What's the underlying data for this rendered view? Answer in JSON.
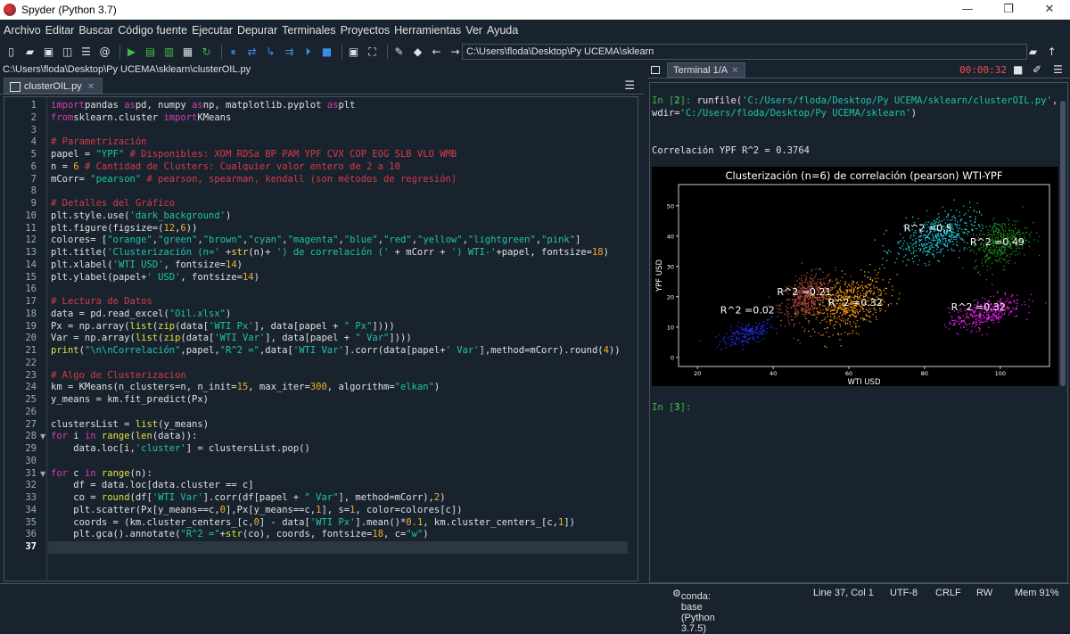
{
  "window": {
    "title": "Spyder (Python 3.7)"
  },
  "menu": [
    "Archivo",
    "Editar",
    "Buscar",
    "Código fuente",
    "Ejecutar",
    "Depurar",
    "Terminales",
    "Proyectos",
    "Herramientas",
    "Ver",
    "Ayuda"
  ],
  "toolbar": {
    "working_dir": "C:\\Users\\floda\\Desktop\\Py UCEMA\\sklearn"
  },
  "editor": {
    "file_path": "C:\\Users\\floda\\Desktop\\Py UCEMA\\sklearn\\clusterOIL.py",
    "tab_label": "clusterOIL.py",
    "current_line": 37,
    "fold_lines": [
      28,
      31
    ],
    "lines": [
      [
        [
          "kw",
          "import"
        ],
        [
          "",
          "pandas "
        ],
        [
          "kw",
          "as"
        ],
        [
          "",
          "pd, numpy "
        ],
        [
          "kw",
          "as"
        ],
        [
          "",
          "np, matplotlib.pyplot "
        ],
        [
          "kw",
          "as"
        ],
        [
          "",
          "plt"
        ]
      ],
      [
        [
          "kw",
          "from"
        ],
        [
          "",
          "sklearn.cluster "
        ],
        [
          "kw",
          "import"
        ],
        [
          "",
          "KMeans"
        ]
      ],
      [],
      [
        [
          "cm",
          "# Parametrización"
        ]
      ],
      [
        [
          "",
          "papel = "
        ],
        [
          "st",
          "\"YPF\""
        ],
        [
          "cm",
          " # Disponibles: XOM RDSa BP PAM YPF CVX COP EOG SLB VLO WMB"
        ]
      ],
      [
        [
          "",
          "n = "
        ],
        [
          "nm",
          "6"
        ],
        [
          "cm",
          " # Cantidad de Clusters: Cualquier valor entero de 2 a 10"
        ]
      ],
      [
        [
          "",
          "mCorr= "
        ],
        [
          "st",
          "\"pearson\""
        ],
        [
          "cm",
          " # pearson, spearman, kendall (son métodos de regresión)"
        ]
      ],
      [],
      [
        [
          "cm",
          "# Detalles del Gráfico"
        ]
      ],
      [
        [
          "",
          "plt.style.use("
        ],
        [
          "st",
          "'dark_background'"
        ],
        [
          "",
          ")"
        ]
      ],
      [
        [
          "",
          "plt.figure(figsize=("
        ],
        [
          "nm",
          "12"
        ],
        [
          "",
          ","
        ],
        [
          "nm",
          "6"
        ],
        [
          "",
          "))"
        ]
      ],
      [
        [
          "",
          "colores= ["
        ],
        [
          "st",
          "\"orange\""
        ],
        [
          "",
          ","
        ],
        [
          "st",
          "\"green\""
        ],
        [
          "",
          ","
        ],
        [
          "st",
          "\"brown\""
        ],
        [
          "",
          ","
        ],
        [
          "st",
          "\"cyan\""
        ],
        [
          "",
          ","
        ],
        [
          "st",
          "\"magenta\""
        ],
        [
          "",
          ","
        ],
        [
          "st",
          "\"blue\""
        ],
        [
          "",
          ","
        ],
        [
          "st",
          "\"red\""
        ],
        [
          "",
          ","
        ],
        [
          "st",
          "\"yellow\""
        ],
        [
          "",
          ","
        ],
        [
          "st",
          "\"lightgreen\""
        ],
        [
          "",
          ","
        ],
        [
          "st",
          "\"pink\""
        ],
        [
          "",
          "]"
        ]
      ],
      [
        [
          "",
          "plt.title("
        ],
        [
          "st",
          "'Clusterización (n='"
        ],
        [
          "",
          " +"
        ],
        [
          "bi",
          "str"
        ],
        [
          "",
          "(n)+ "
        ],
        [
          "st",
          "') de correlación ('"
        ],
        [
          "",
          " + mCorr + "
        ],
        [
          "st",
          "') WTI-'"
        ],
        [
          "",
          "+papel, fontsize="
        ],
        [
          "nm",
          "18"
        ],
        [
          "",
          ")"
        ]
      ],
      [
        [
          "",
          "plt.xlabel("
        ],
        [
          "st",
          "'WTI USD'"
        ],
        [
          "",
          ", fontsize="
        ],
        [
          "nm",
          "14"
        ],
        [
          "",
          ")"
        ]
      ],
      [
        [
          "",
          "plt.ylabel(papel+"
        ],
        [
          "st",
          "' USD'"
        ],
        [
          "",
          ", fontsize="
        ],
        [
          "nm",
          "14"
        ],
        [
          "",
          ")"
        ]
      ],
      [],
      [
        [
          "cm",
          "# Lectura de Datos"
        ]
      ],
      [
        [
          "",
          "data = pd.read_excel("
        ],
        [
          "st",
          "\"Oil.xlsx\""
        ],
        [
          "",
          ")"
        ]
      ],
      [
        [
          "",
          "Px = np.array("
        ],
        [
          "bi",
          "list"
        ],
        [
          "",
          "("
        ],
        [
          "bi",
          "zip"
        ],
        [
          "",
          "(data["
        ],
        [
          "st",
          "'WTI Px'"
        ],
        [
          "",
          "], data[papel + "
        ],
        [
          "st",
          "\" Px\""
        ],
        [
          "",
          "])))"
        ]
      ],
      [
        [
          "",
          "Var = np.array("
        ],
        [
          "bi",
          "list"
        ],
        [
          "",
          "("
        ],
        [
          "bi",
          "zip"
        ],
        [
          "",
          "(data["
        ],
        [
          "st",
          "'WTI Var'"
        ],
        [
          "",
          "], data[papel + "
        ],
        [
          "st",
          "\" Var\""
        ],
        [
          "",
          "])))"
        ]
      ],
      [
        [
          "bi",
          "print"
        ],
        [
          "",
          "("
        ],
        [
          "st",
          "\"\\n\\nCorrelación\""
        ],
        [
          "",
          ",papel,"
        ],
        [
          "st",
          "\"R^2 =\""
        ],
        [
          "",
          ",data["
        ],
        [
          "st",
          "'WTI Var'"
        ],
        [
          "",
          "].corr(data[papel+"
        ],
        [
          "st",
          "' Var'"
        ],
        [
          "",
          "],method=mCorr).round("
        ],
        [
          "nm",
          "4"
        ],
        [
          "",
          "))"
        ]
      ],
      [],
      [
        [
          "cm",
          "# Algo de Clusterizacion"
        ]
      ],
      [
        [
          "",
          "km = KMeans(n_clusters=n, n_init="
        ],
        [
          "nm",
          "15"
        ],
        [
          "",
          ", max_iter="
        ],
        [
          "nm",
          "300"
        ],
        [
          "",
          ", algorithm="
        ],
        [
          "st",
          "\"elkan\""
        ],
        [
          "",
          ")"
        ]
      ],
      [
        [
          "",
          "y_means = km.fit_predict(Px)"
        ]
      ],
      [],
      [
        [
          "",
          "clustersList = "
        ],
        [
          "bi",
          "list"
        ],
        [
          "",
          "(y_means)"
        ]
      ],
      [
        [
          "kw",
          "for"
        ],
        [
          "",
          " i "
        ],
        [
          "kw",
          "in"
        ],
        [
          "",
          " "
        ],
        [
          "bi",
          "range"
        ],
        [
          "",
          "("
        ],
        [
          "bi",
          "len"
        ],
        [
          "",
          "(data)):"
        ]
      ],
      [
        [
          "",
          "    data.loc[i,"
        ],
        [
          "st",
          "'cluster'"
        ],
        [
          "",
          "] = clustersList.pop()"
        ]
      ],
      [],
      [
        [
          "kw",
          "for"
        ],
        [
          "",
          " c "
        ],
        [
          "kw",
          "in"
        ],
        [
          "",
          " "
        ],
        [
          "bi",
          "range"
        ],
        [
          "",
          "(n):"
        ]
      ],
      [
        [
          "",
          "    df = data.loc[data.cluster == c]"
        ]
      ],
      [
        [
          "",
          "    co = "
        ],
        [
          "bi",
          "round"
        ],
        [
          "",
          "(df["
        ],
        [
          "st",
          "'WTI Var'"
        ],
        [
          "",
          "].corr(df[papel + "
        ],
        [
          "st",
          "\" Var\""
        ],
        [
          "",
          "], method=mCorr),"
        ],
        [
          "nm",
          "2"
        ],
        [
          "",
          ")"
        ]
      ],
      [
        [
          "",
          "    plt.scatter(Px[y_means==c,"
        ],
        [
          "nm",
          "0"
        ],
        [
          "",
          "],Px[y_means==c,"
        ],
        [
          "nm",
          "1"
        ],
        [
          "",
          "], s="
        ],
        [
          "nm",
          "1"
        ],
        [
          "",
          ", color=colores[c])"
        ]
      ],
      [
        [
          "",
          "    coords = (km.cluster_centers_[c,"
        ],
        [
          "nm",
          "0"
        ],
        [
          "",
          "] - data["
        ],
        [
          "st",
          "'WTI Px'"
        ],
        [
          "",
          "].mean()*"
        ],
        [
          "nm",
          "0.1"
        ],
        [
          "",
          ", km.cluster_centers_[c,"
        ],
        [
          "nm",
          "1"
        ],
        [
          "",
          "])"
        ]
      ],
      [
        [
          "",
          "    plt.gca().annotate("
        ],
        [
          "st",
          "\"R^2 =\""
        ],
        [
          "",
          "+"
        ],
        [
          "bi",
          "str"
        ],
        [
          "",
          "(co), coords, fontsize="
        ],
        [
          "nm",
          "18"
        ],
        [
          "",
          ", c="
        ],
        [
          "st",
          "\"w\""
        ],
        [
          "",
          ")"
        ]
      ],
      []
    ]
  },
  "console": {
    "tab_label": "Terminal 1/A",
    "timer": "00:00:32",
    "in_label": "In [",
    "in2_num": "2",
    "in2_end": "]: ",
    "in2_cmd_a": "runfile(",
    "in2_str1": "'C:/Users/floda/Desktop/Py UCEMA/sklearn/clusterOIL.py'",
    "in2_cmd_b": ",",
    "in2_cmd_c": "wdir=",
    "in2_str2": "'C:/Users/floda/Desktop/Py UCEMA/sklearn'",
    "in2_cmd_d": ")",
    "output": "Correlación YPF R^2 = 0.3764",
    "in3_num": "3",
    "in3_end": "]:"
  },
  "colors": {
    "orange": "#ff9f1a",
    "green": "#1f8f1f",
    "brown": "#b04a3a",
    "cyan": "#22d3e0",
    "magenta": "#e61ee6",
    "blue": "#2233ff",
    "white": "#ffffff"
  },
  "chart_data": {
    "type": "scatter",
    "title": "Clusterización (n=6) de correlación (pearson) WTI-YPF",
    "xlabel": "WTI USD",
    "ylabel": "YPF USD",
    "xlim": [
      15,
      113
    ],
    "ylim": [
      -3,
      57
    ],
    "xticks": [
      20,
      40,
      60,
      80,
      100
    ],
    "yticks": [
      0,
      10,
      20,
      30,
      40,
      50
    ],
    "clusters": [
      {
        "color": "blue",
        "center": [
          33,
          8
        ],
        "spread": [
          6,
          3
        ],
        "count": 180
      },
      {
        "color": "brown",
        "center": [
          49,
          20
        ],
        "spread": [
          6,
          6
        ],
        "count": 520
      },
      {
        "color": "orange",
        "center": [
          60,
          18
        ],
        "spread": [
          8,
          7
        ],
        "count": 560
      },
      {
        "color": "cyan",
        "center": [
          83,
          40
        ],
        "spread": [
          9,
          6
        ],
        "count": 480
      },
      {
        "color": "green",
        "center": [
          100,
          38
        ],
        "spread": [
          6,
          6
        ],
        "count": 420
      },
      {
        "color": "magenta",
        "center": [
          96,
          15
        ],
        "spread": [
          8,
          4
        ],
        "count": 380
      }
    ],
    "annotations": [
      {
        "text": "R^2 =0.02",
        "x": 26,
        "y": 14.5
      },
      {
        "text": "R^2 =0.21",
        "x": 41,
        "y": 20.5
      },
      {
        "text": "R^2 =0.32",
        "x": 54.5,
        "y": 17
      },
      {
        "text": "R^2 =0.5",
        "x": 74.5,
        "y": 41.5
      },
      {
        "text": "R^2 =0.49",
        "x": 92,
        "y": 37
      },
      {
        "text": "R^2 =0.32",
        "x": 87,
        "y": 15.5
      }
    ]
  },
  "status": {
    "conda": "conda: base (Python 3.7.5)",
    "position": "Line 37, Col 1",
    "encoding": "UTF-8",
    "eol": "CRLF",
    "perm": "RW",
    "mem": "Mem 91%"
  }
}
